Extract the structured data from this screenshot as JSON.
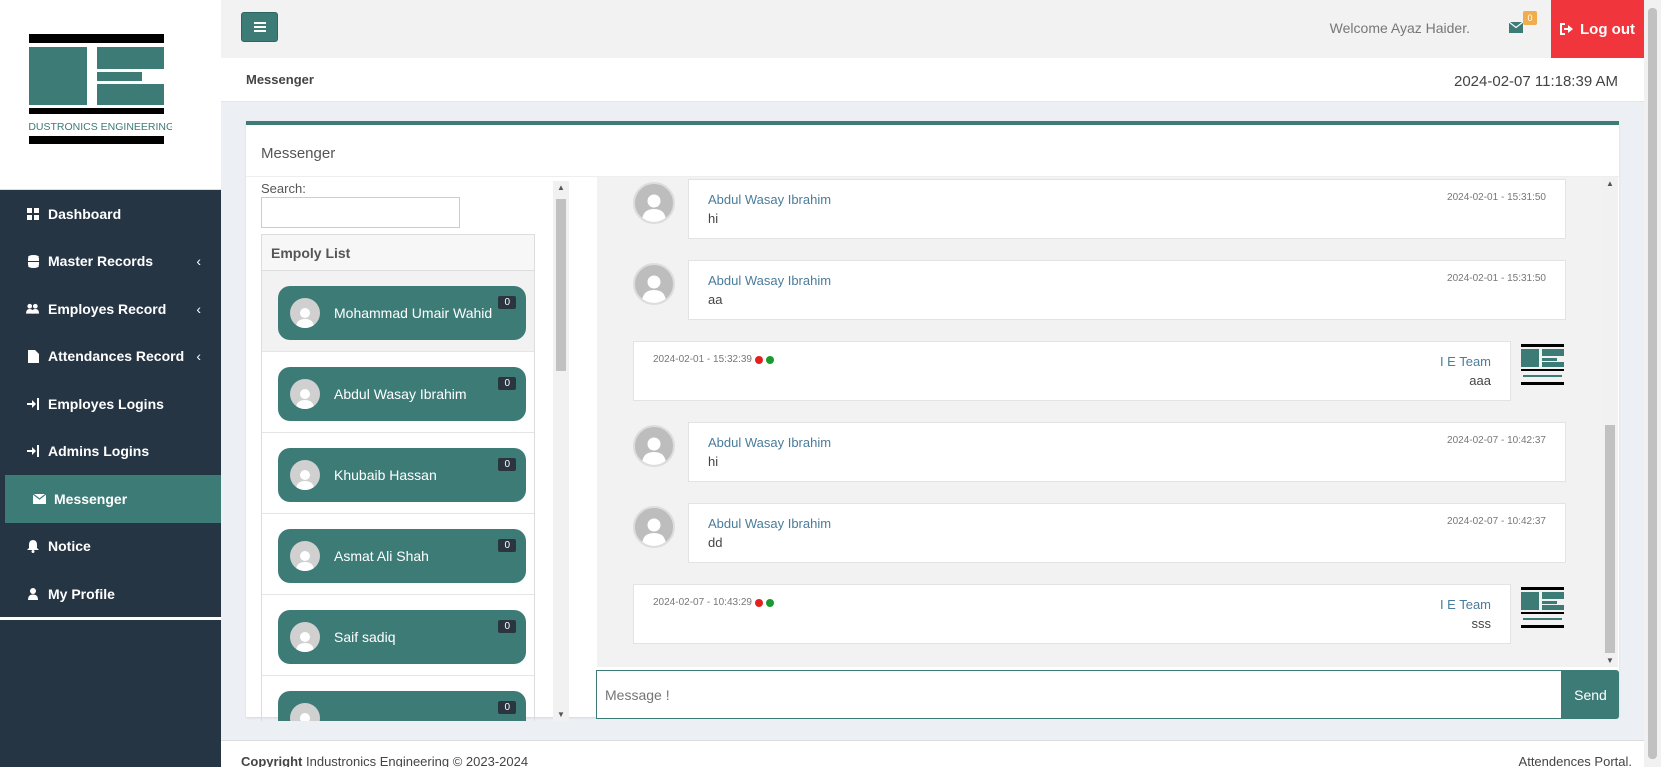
{
  "brand": {
    "logo_text": "INDUSTRONICS ENGINEERING",
    "accent": "#3d7b77",
    "sidebar_bg": "#263544",
    "logout_bg": "#f0353d"
  },
  "sidebar": {
    "items": [
      {
        "label": "Dashboard",
        "icon": "grid-icon",
        "has_children": false
      },
      {
        "label": "Master Records",
        "icon": "database-icon",
        "has_children": true
      },
      {
        "label": "Employes Record",
        "icon": "users-icon",
        "has_children": true
      },
      {
        "label": "Attendances Record",
        "icon": "file-icon",
        "has_children": true
      },
      {
        "label": "Employes Logins",
        "icon": "sign-in-icon",
        "has_children": false
      },
      {
        "label": "Admins Logins",
        "icon": "sign-in-icon",
        "has_children": false
      },
      {
        "label": "Messenger",
        "icon": "envelope-icon",
        "has_children": false,
        "active": true
      },
      {
        "label": "Notice",
        "icon": "bell-icon",
        "has_children": false
      },
      {
        "label": "My Profile",
        "icon": "user-icon",
        "has_children": false
      }
    ]
  },
  "topbar": {
    "welcome": "Welcome Ayaz Haider.",
    "mail_count": "0",
    "logout_label": "Log out"
  },
  "page_header": {
    "title": "Messenger",
    "datetime": "2024-02-07 11:18:39 AM"
  },
  "panel": {
    "title": "Messenger",
    "search_label": "Search:",
    "list_header": "Empoly List",
    "employees": [
      {
        "name": "Mohammad Umair Wahid",
        "count": "0"
      },
      {
        "name": "Abdul Wasay Ibrahim",
        "count": "0"
      },
      {
        "name": "Khubaib Hassan",
        "count": "0"
      },
      {
        "name": "Asmat Ali Shah",
        "count": "0"
      },
      {
        "name": "Saif sadiq",
        "count": "0"
      },
      {
        "name": "",
        "count": "0"
      }
    ]
  },
  "messages": [
    {
      "direction": "in",
      "name": "Abdul Wasay Ibrahim",
      "text": "hi",
      "time": "2024-02-01 - 15:31:50"
    },
    {
      "direction": "in",
      "name": "Abdul Wasay Ibrahim",
      "text": "aa",
      "time": "2024-02-01 - 15:31:50"
    },
    {
      "direction": "out",
      "name": "I E Team",
      "text": "aaa",
      "time": "2024-02-01 - 15:32:39"
    },
    {
      "direction": "in",
      "name": "Abdul Wasay Ibrahim",
      "text": "hi",
      "time": "2024-02-07 - 10:42:37"
    },
    {
      "direction": "in",
      "name": "Abdul Wasay Ibrahim",
      "text": "dd",
      "time": "2024-02-07 - 10:42:37"
    },
    {
      "direction": "out",
      "name": "I E Team",
      "text": "sss",
      "time": "2024-02-07 - 10:43:29"
    }
  ],
  "composer": {
    "placeholder": "Message !",
    "send_label": "Send"
  },
  "footer": {
    "copyright_label": "Copyright",
    "copyright_text": " Industronics Engineering © 2023-2024",
    "right_text": "Attendences Portal."
  }
}
